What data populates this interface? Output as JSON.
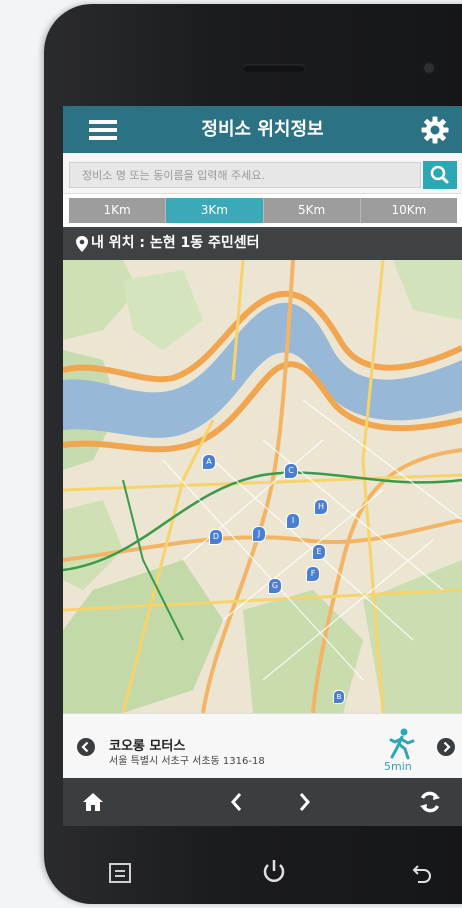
{
  "app": {
    "title": "정비소 위치정보"
  },
  "search": {
    "placeholder": "정비소 명 또는 동이름을 입력해 주세요."
  },
  "distance_tabs": [
    {
      "label": "1Km",
      "active": false
    },
    {
      "label": "3Km",
      "active": true
    },
    {
      "label": "5Km",
      "active": false
    },
    {
      "label": "10Km",
      "active": false
    }
  ],
  "location": {
    "text": "내 위치 : 논현 1동 주민센터"
  },
  "map": {
    "markers": [
      "A",
      "B",
      "C",
      "D",
      "E",
      "F",
      "G",
      "H",
      "I",
      "J"
    ]
  },
  "shop": {
    "name": "코오롱 모터스",
    "address": "서울 특별시 서초구 서초동 1316-18",
    "walk_time": "5min"
  },
  "icons": {
    "menu": "menu-icon",
    "settings": "gear-icon",
    "search": "search-icon",
    "location": "location-pin-icon",
    "prev": "chevron-left-icon",
    "next": "chevron-right-icon",
    "walk": "walking-person-icon",
    "home": "home-icon",
    "refresh": "refresh-icon",
    "power": "power-icon",
    "back": "back-icon"
  },
  "colors": {
    "header": "#2a7284",
    "accent": "#2ea7b5",
    "tab_inactive": "#9d9d9d",
    "location_bar": "#3e4244",
    "bottom_bar": "#3b3e41"
  }
}
